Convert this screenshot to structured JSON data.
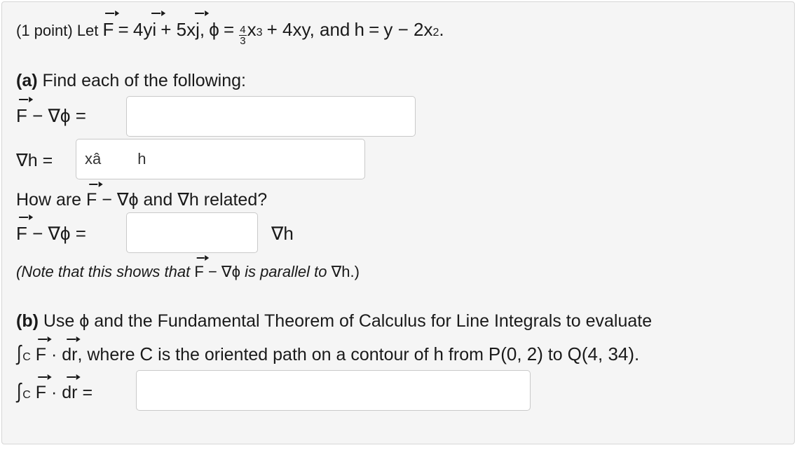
{
  "problem": {
    "intro_pts": "(1 point) Let",
    "F": "F",
    "eq": "=",
    "F_def_a": "4y",
    "F_def_i": "i",
    "F_def_b": "+ 5x",
    "F_def_j": "j",
    "comma1": ",",
    "phi": "ϕ",
    "frac_num": "4",
    "frac_den": "3",
    "phi_def_x": "x",
    "phi_def_exp": "3",
    "phi_def_rest": "+ 4xy, and",
    "h": "h",
    "h_def": "y − 2x",
    "h_exp": "2",
    "period": "."
  },
  "part_a": {
    "label": "(a)",
    "text": "Find each of the following:",
    "row1_lhs_rest": "− ∇ϕ =",
    "row2_lhs": "∇h =",
    "grad_h_value": "xâ",
    "grad_h_value2": "h",
    "question_pre": "How are",
    "question_mid": "− ∇ϕ",
    "question_and": "and",
    "question_grad": "∇h",
    "question_post": "related?",
    "row3_lhs_rest": "− ∇ϕ =",
    "row3_rhs": "∇h",
    "note_pre": "(Note that this shows that",
    "note_mid": "− ∇ϕ",
    "note_post": "is parallel to",
    "note_grad": "∇h.)"
  },
  "part_b": {
    "label": "(b)",
    "text_pre": "Use",
    "text_post": "and the Fundamental Theorem of Calculus for Line Integrals to evaluate",
    "integral_sym": "∫",
    "C": "C",
    "dot": "·",
    "dr": "dr",
    "line2_post": ", where",
    "line2_C": "C",
    "line2_rest": "is the oriented path on a contour of",
    "line2_h": "h",
    "line2_from": "from",
    "P": "P(0, 2)",
    "to": "to",
    "Q": "Q(4, 34).",
    "answer_eq": "="
  },
  "colors": {
    "panel_bg": "#f5f5f5",
    "input_bg": "#ffffff",
    "input_border": "#c9c9c9"
  }
}
